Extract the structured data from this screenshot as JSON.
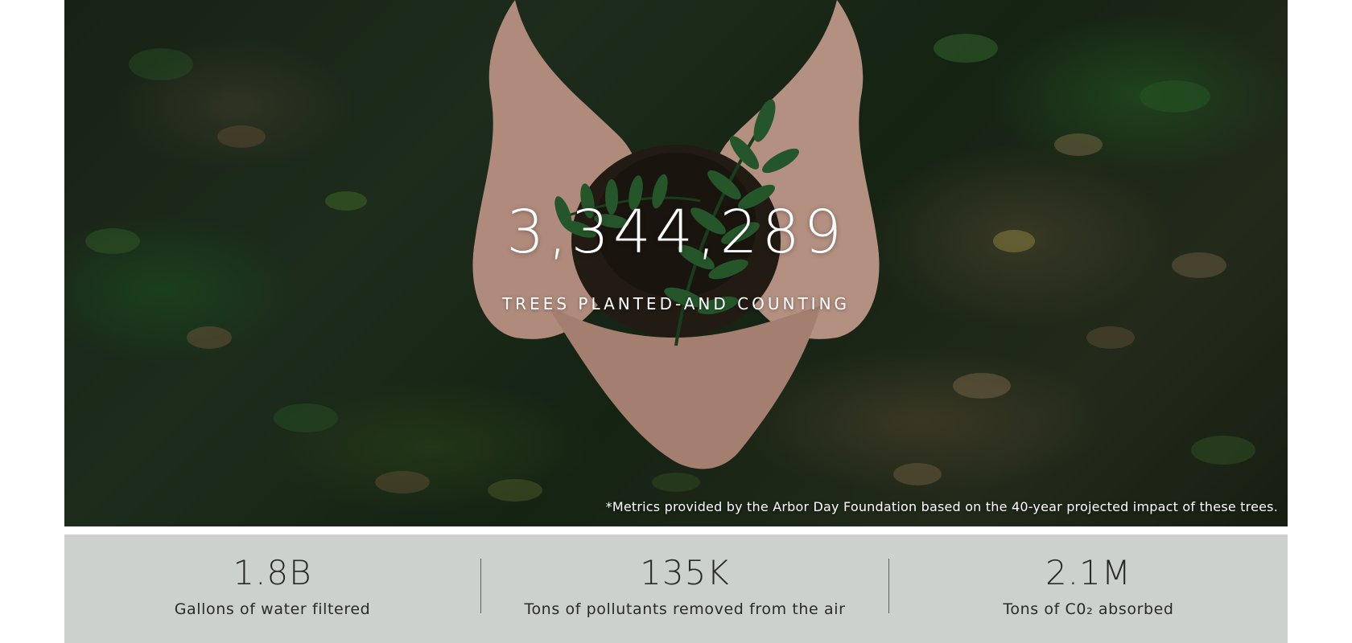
{
  "hero": {
    "count": "3,344,289",
    "subtitle": "TREES PLANTED-AND COUNTING",
    "footnote": "*Metrics provided by the Arbor Day Foundation based on the 40-year projected impact of these trees.",
    "image_description": "hands-holding-soil-with-seedling-photo"
  },
  "stats": [
    {
      "value": "1.8B",
      "label": "Gallons of water filtered"
    },
    {
      "value": "135K",
      "label": "Tons of pollutants removed from the air"
    },
    {
      "value": "2.1M",
      "label": "Tons of C0₂ absorbed"
    }
  ],
  "colors": {
    "stats_background": "#ccd1cd",
    "text_dark": "#2a2a2a",
    "text_light": "#ffffff",
    "divider": "#5e625f"
  }
}
